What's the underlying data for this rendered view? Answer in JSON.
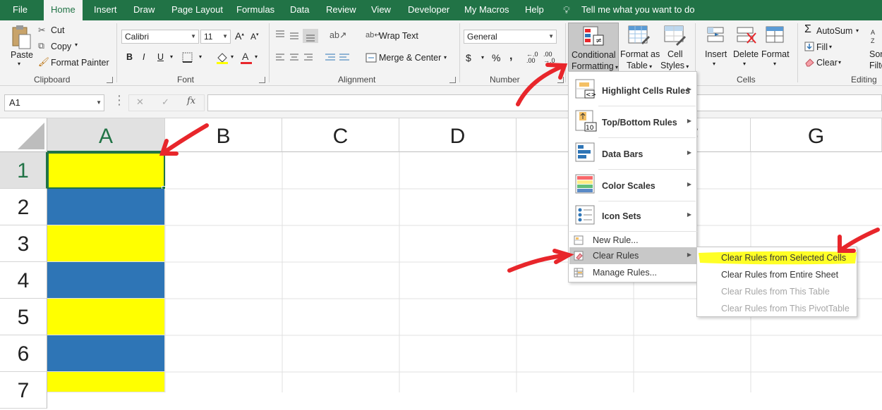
{
  "menu_tabs": [
    "File",
    "Home",
    "Insert",
    "Draw",
    "Page Layout",
    "Formulas",
    "Data",
    "Review",
    "View",
    "Developer",
    "My Macros",
    "Help"
  ],
  "tell_me": "Tell me what you want to do",
  "clipboard": {
    "paste": "Paste",
    "cut": "Cut",
    "copy": "Copy",
    "format_painter": "Format Painter",
    "label": "Clipboard"
  },
  "font": {
    "name": "Calibri",
    "size": "11",
    "bold": "B",
    "italic": "I",
    "underline": "U",
    "label": "Font"
  },
  "alignment": {
    "wrap_text": "Wrap Text",
    "merge_center": "Merge & Center",
    "label": "Alignment"
  },
  "number": {
    "format": "General",
    "currency": "$",
    "percent": "%",
    "comma": ",",
    "label": "Number"
  },
  "styles": {
    "conditional_formatting_line1": "Conditional",
    "conditional_formatting_line2": "Formatting",
    "format_as_table_line1": "Format as",
    "format_as_table_line2": "Table",
    "cell_styles_line1": "Cell",
    "cell_styles_line2": "Styles"
  },
  "cells": {
    "insert": "Insert",
    "delete": "Delete",
    "format": "Format",
    "label": "Cells"
  },
  "editing": {
    "autosum": "AutoSum",
    "fill": "Fill",
    "clear": "Clear",
    "sort_line1": "Sor",
    "sort_line2": "Filte",
    "label": "Editing"
  },
  "formula_bar": {
    "name_box": "A1",
    "fx": "fx",
    "cancel": "✕",
    "enter": "✓",
    "formula": ""
  },
  "columns": [
    "A",
    "B",
    "C",
    "D",
    "E",
    "F",
    "G"
  ],
  "rows": [
    "1",
    "2",
    "3",
    "4",
    "5",
    "6",
    "7"
  ],
  "cell_colors": {
    "yellow": "#ffff00",
    "blue": "#2e75b6"
  },
  "cf_menu": {
    "highlight": "Highlight Cells Rules",
    "topbottom": "Top/Bottom Rules",
    "databars": "Data Bars",
    "colorscales": "Color Scales",
    "iconsets": "Icon Sets",
    "newrule": "New Rule...",
    "clearrules": "Clear Rules",
    "managerules": "Manage Rules..."
  },
  "clear_submenu": [
    "Clear Rules from Selected Cells",
    "Clear Rules from Entire Sheet",
    "Clear Rules from This Table",
    "Clear Rules from This PivotTable"
  ],
  "accent_color": "#217346",
  "annotation_color": "#e8262b",
  "highlight_color": "#ffff1a"
}
